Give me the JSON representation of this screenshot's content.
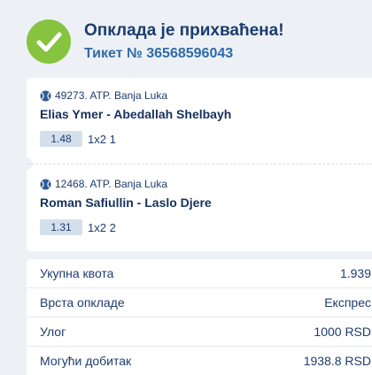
{
  "header": {
    "title": "Опклада је прихваћена!",
    "ticket": "Тикет № 36568596043"
  },
  "events": [
    {
      "league": "49273. ATP. Banja Luka",
      "match": "Elias Ymer - Abedallah Shelbayh",
      "odd": "1.48",
      "pick": "1x2 1",
      "icon": "tennis-ball-icon"
    },
    {
      "league": "12468. ATP. Banja Luka",
      "match": "Roman Safiullin - Laslo Djere",
      "odd": "1.31",
      "pick": "1x2 2",
      "icon": "tennis-ball-icon"
    }
  ],
  "summary": [
    {
      "label": "Укупна квота",
      "value": "1.939"
    },
    {
      "label": "Врста опкладе",
      "value": "Експрес"
    },
    {
      "label": "Улог",
      "value": "1000 RSD"
    },
    {
      "label": "Могући добитак",
      "value": "1938.8 RSD"
    }
  ],
  "colors": {
    "accent_green": "#86c440",
    "title_blue": "#1d3c6e",
    "ticket_blue": "#2f6aa8",
    "badge_bg": "#d5dfec",
    "page_bg": "#edf1f6"
  }
}
